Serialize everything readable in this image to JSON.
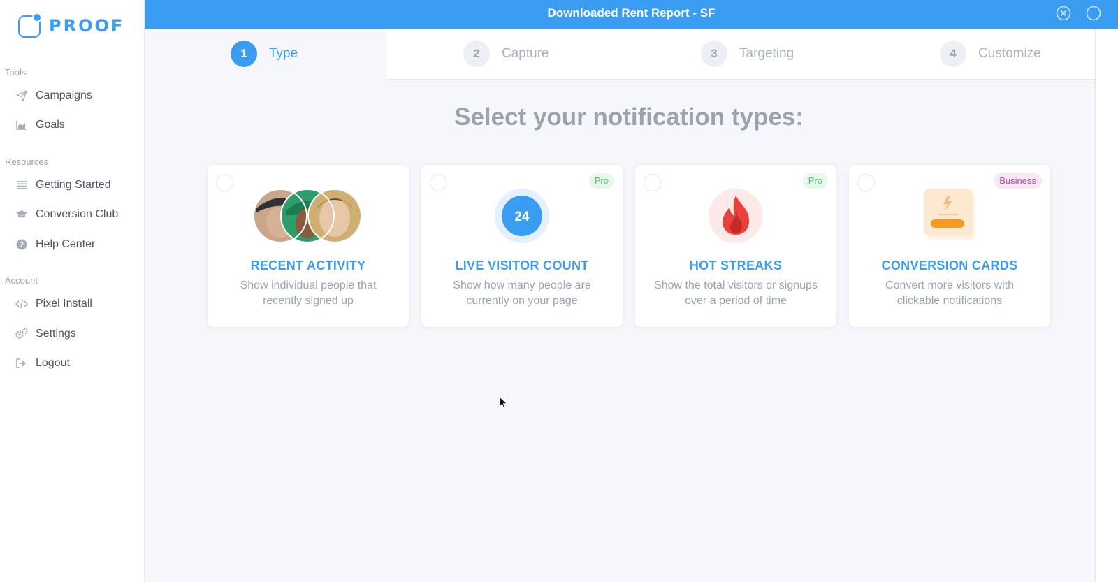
{
  "app": {
    "brand": "PROOF",
    "window_title": "Downloaded Rent Report - SF"
  },
  "sidebar": {
    "sections": [
      {
        "label": "Tools",
        "items": [
          {
            "label": "Campaigns",
            "icon": "paper-plane-icon"
          },
          {
            "label": "Goals",
            "icon": "area-chart-icon"
          }
        ]
      },
      {
        "label": "Resources",
        "items": [
          {
            "label": "Getting Started",
            "icon": "list-icon"
          },
          {
            "label": "Conversion Club",
            "icon": "graduation-cap-icon"
          },
          {
            "label": "Help Center",
            "icon": "question-circle-icon"
          }
        ]
      },
      {
        "label": "Account",
        "items": [
          {
            "label": "Pixel Install",
            "icon": "code-icon"
          },
          {
            "label": "Settings",
            "icon": "cogs-icon"
          },
          {
            "label": "Logout",
            "icon": "sign-out-icon"
          }
        ]
      }
    ]
  },
  "stepper": {
    "steps": [
      {
        "number": "1",
        "label": "Type",
        "active": true
      },
      {
        "number": "2",
        "label": "Capture",
        "active": false
      },
      {
        "number": "3",
        "label": "Targeting",
        "active": false
      },
      {
        "number": "4",
        "label": "Customize",
        "active": false
      }
    ]
  },
  "main": {
    "heading": "Select your notification types:",
    "cards": [
      {
        "title": "RECENT ACTIVITY",
        "description": "Show individual people that recently signed up",
        "badge": "",
        "icon": "avatar-group-icon"
      },
      {
        "title": "LIVE VISITOR COUNT",
        "description": "Show how many people are currently on your page",
        "badge": "Pro",
        "counter": "24",
        "icon": "visitor-count-icon"
      },
      {
        "title": "HOT STREAKS",
        "description": "Show the total visitors or signups over a period of time",
        "badge": "Pro",
        "icon": "flame-icon"
      },
      {
        "title": "CONVERSION CARDS",
        "description": "Convert more visitors with clickable notifications",
        "badge": "Business",
        "icon": "cards-icon"
      }
    ]
  },
  "colors": {
    "accent": "#3a9df2",
    "pro_badge": "#4cc46e",
    "business_badge": "#b04aa6",
    "flame": "#e8413a"
  }
}
